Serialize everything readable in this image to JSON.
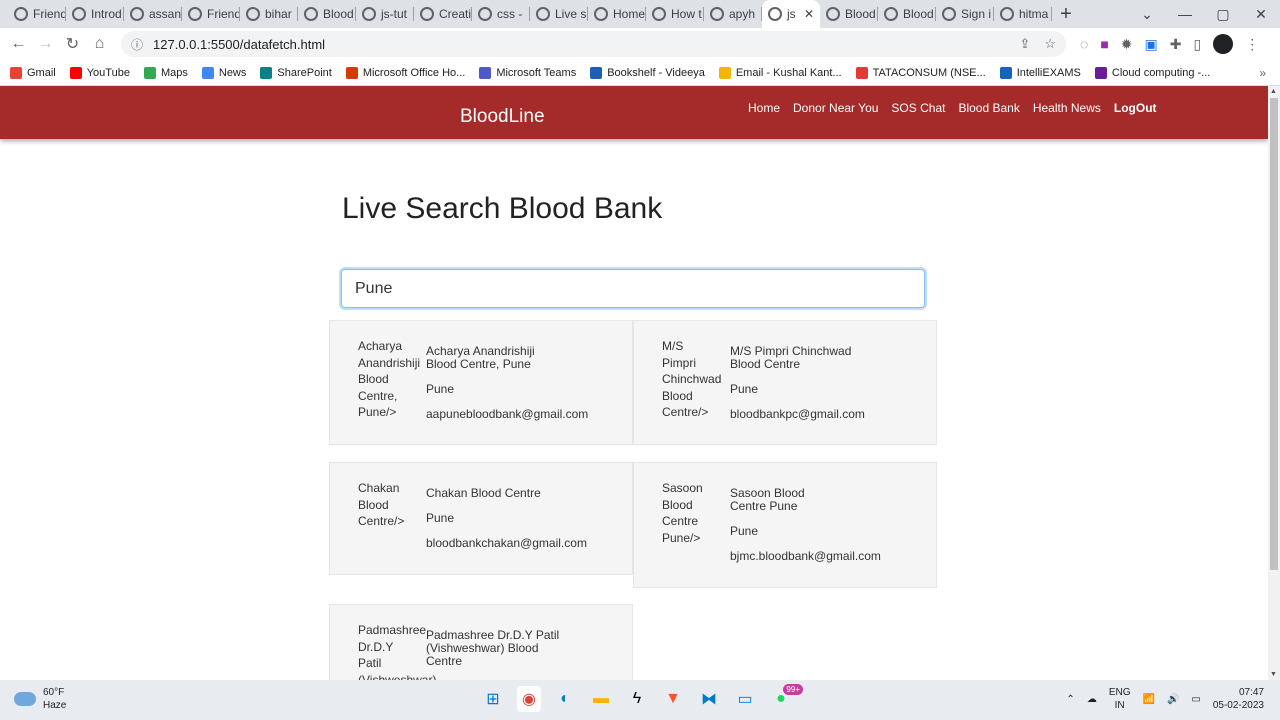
{
  "browser": {
    "tabs": [
      {
        "label": "Friend"
      },
      {
        "label": "Introd"
      },
      {
        "label": "assan"
      },
      {
        "label": "Friend"
      },
      {
        "label": "bihar"
      },
      {
        "label": "Blood"
      },
      {
        "label": "js-tut"
      },
      {
        "label": "Creati"
      },
      {
        "label": "css -"
      },
      {
        "label": "Live s"
      },
      {
        "label": "Home"
      },
      {
        "label": "How t"
      },
      {
        "label": "apyh"
      },
      {
        "label": "js"
      },
      {
        "label": "Blood"
      },
      {
        "label": "Blood"
      },
      {
        "label": "Sign i"
      },
      {
        "label": "hitma"
      }
    ],
    "active_tab_index": 13,
    "url": "127.0.0.1:5500/datafetch.html",
    "bookmarks": [
      {
        "label": "Gmail",
        "color": "#ea4335"
      },
      {
        "label": "YouTube",
        "color": "#ff0000"
      },
      {
        "label": "Maps",
        "color": "#34a853"
      },
      {
        "label": "News",
        "color": "#4285f4"
      },
      {
        "label": "SharePoint",
        "color": "#038387"
      },
      {
        "label": "Microsoft Office Ho...",
        "color": "#d83b01"
      },
      {
        "label": "Microsoft Teams",
        "color": "#5059c9"
      },
      {
        "label": "Bookshelf - Videeya",
        "color": "#1a5fb4"
      },
      {
        "label": "Email - Kushal Kant...",
        "color": "#f4b400"
      },
      {
        "label": "TATACONSUM (NSE...",
        "color": "#e53935"
      },
      {
        "label": "IntelliEXAMS",
        "color": "#1565c0"
      },
      {
        "label": "Cloud computing -...",
        "color": "#6a1b9a"
      }
    ],
    "bookmarks_more": "»"
  },
  "site": {
    "brand": "BloodLine",
    "nav": [
      "Home",
      "Donor Near You",
      "SOS Chat",
      "Blood Bank",
      "Health News"
    ],
    "logout": "LogOut",
    "brand_color": "#a52a2a"
  },
  "main": {
    "title": "Live Search Blood Bank",
    "search_value": "Pune"
  },
  "results": [
    {
      "name_lines": [
        "Acharya",
        "Anandrishiji",
        "Blood",
        "Centre,",
        "Pune/>"
      ],
      "name": "Acharya Anandrishiji Blood Centre, Pune",
      "city": "Pune",
      "email": "aapunebloodbank@gmail.com"
    },
    {
      "name_lines": [
        "M/S",
        "Pimpri",
        "Chinchwad",
        "Blood",
        "Centre/>"
      ],
      "name": "M/S Pimpri Chinchwad Blood Centre",
      "city": "Pune",
      "email": "bloodbankpc@gmail.com"
    },
    {
      "name_lines": [
        "Chakan",
        "Blood",
        "Centre/>"
      ],
      "name": "Chakan Blood Centre",
      "city": "Pune",
      "email": "bloodbankchakan@gmail.com"
    },
    {
      "name_lines": [
        "Sasoon",
        "Blood",
        "Centre",
        "Pune/>"
      ],
      "name": "Sasoon Blood Centre Pune",
      "city": "Pune",
      "email": "bjmc.bloodbank@gmail.com"
    },
    {
      "name_lines": [
        "Padmashree",
        "Dr.D.Y",
        "Patil",
        "(Vishweshwar)"
      ],
      "name": "Padmashree Dr.D.Y Patil (Vishweshwar) Blood Centre",
      "city": "",
      "email": ""
    }
  ],
  "taskbar": {
    "temp": "60°F",
    "weather": "Haze",
    "badge": "99+",
    "lang1": "ENG",
    "lang2": "IN",
    "time": "07:47",
    "date": "05-02-2023"
  }
}
